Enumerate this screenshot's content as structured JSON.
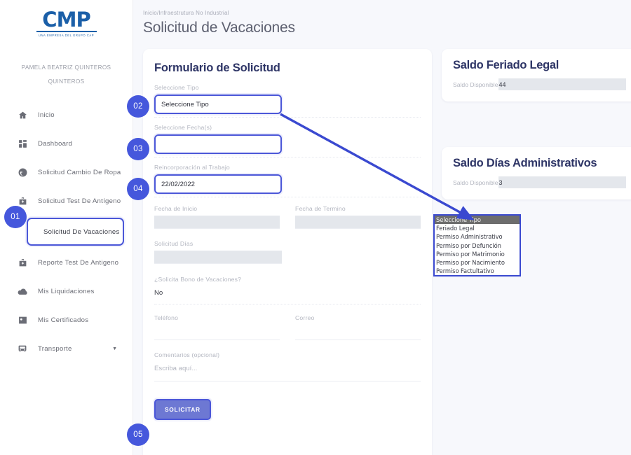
{
  "brand": {
    "logo_text": "CMP",
    "logo_tagline": "UNA EMPRESA DEL GRUPO CAP"
  },
  "sidebar": {
    "user_name_line1": "PAMELA BEATRIZ QUINTEROS",
    "user_name_line2": "QUINTEROS",
    "items": [
      {
        "label": "Inicio",
        "icon": "home-icon",
        "active": false,
        "caret": false
      },
      {
        "label": "Dashboard",
        "icon": "dashboard-grid-icon",
        "active": false,
        "caret": false
      },
      {
        "label": "Solicitud Cambio De Ropa",
        "icon": "refresh-circle-icon",
        "active": false,
        "caret": false
      },
      {
        "label": "Solicitud Test De Antígeno",
        "icon": "medical-kit-icon",
        "active": false,
        "caret": false
      },
      {
        "label": "Solicitud De Vacaciones",
        "icon": "none",
        "active": true,
        "caret": false
      },
      {
        "label": "Reporte Test De Antigeno",
        "icon": "medical-kit-icon",
        "active": false,
        "caret": false
      },
      {
        "label": "Mis Liquidaciones",
        "icon": "cloud-icon",
        "active": false,
        "caret": false
      },
      {
        "label": "Mis Certificados",
        "icon": "id-card-icon",
        "active": false,
        "caret": false
      },
      {
        "label": "Transporte",
        "icon": "bus-icon",
        "active": false,
        "caret": true
      }
    ]
  },
  "header": {
    "breadcrumb": "Inicio/Infraestrutura No Industrial",
    "title": "Solicitud de Vacaciones"
  },
  "form": {
    "title": "Formulario de Solicitud",
    "tipo_label": "Seleccione Tipo",
    "tipo_value": "Seleccione Tipo",
    "fechas_label": "Seleccione Fecha(s)",
    "fechas_value": "",
    "reincorporacion_label": "Reincorporación al Trabajo",
    "reincorporacion_value": "22/02/2022",
    "fecha_inicio_label": "Fecha de Inicio",
    "fecha_inicio_value": "",
    "fecha_termino_label": "Fecha de Termino",
    "fecha_termino_value": "",
    "solicitud_dias_label": "Solicitud Días",
    "solicitud_dias_value": "",
    "bono_label": "¿Solicita Bono de Vacaciones?",
    "bono_value": "No",
    "telefono_label": "Teléfono",
    "telefono_value": "",
    "correo_label": "Correo",
    "correo_value": "",
    "comentarios_label": "Comentarios (opcional)",
    "comentarios_placeholder": "Escriba aquí...",
    "submit_label": "SOLICITAR"
  },
  "cards": [
    {
      "title": "Saldo Feriado Legal",
      "label": "Saldo Disponible",
      "value": "44"
    },
    {
      "title": "Saldo Días Administrativos",
      "label": "Saldo Disponible",
      "value": "3"
    }
  ],
  "dropdown": {
    "options": [
      "Seleccione Tipo",
      "Feriado Legal",
      "Permiso Administrativo",
      "Permiso por Defunción",
      "Permiso por Matrimonio",
      "Permiso por Nacimiento",
      "Permiso Factultativo"
    ],
    "selected_index": 0
  },
  "annotations": {
    "badges": [
      "01",
      "02",
      "03",
      "04",
      "05"
    ],
    "accent_color": "#4557dc",
    "highlight_color": "#4b57d8"
  }
}
